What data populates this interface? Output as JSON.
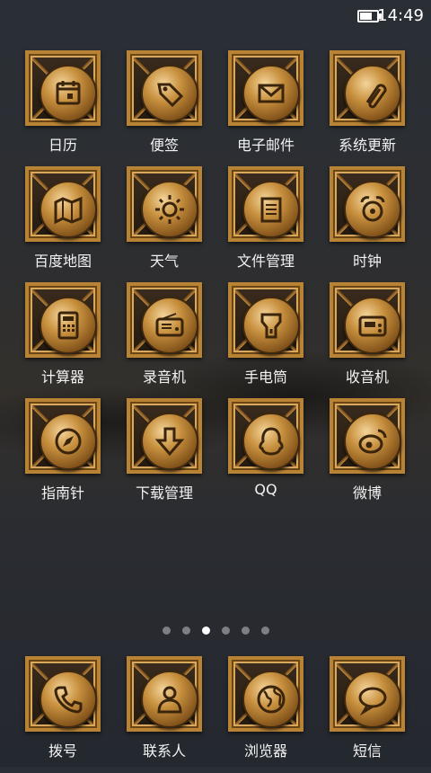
{
  "status_bar": {
    "time": "14:49",
    "battery_level": 0.8
  },
  "apps": [
    {
      "label": "日历",
      "icon": "calendar-icon"
    },
    {
      "label": "便签",
      "icon": "tag-icon"
    },
    {
      "label": "电子邮件",
      "icon": "mail-icon"
    },
    {
      "label": "系统更新",
      "icon": "paperclip-icon"
    },
    {
      "label": "百度地图",
      "icon": "map-icon"
    },
    {
      "label": "天气",
      "icon": "sun-icon"
    },
    {
      "label": "文件管理",
      "icon": "notepad-icon"
    },
    {
      "label": "时钟",
      "icon": "alarm-clock-icon"
    },
    {
      "label": "计算器",
      "icon": "calculator-icon"
    },
    {
      "label": "录音机",
      "icon": "radio-recorder-icon"
    },
    {
      "label": "手电筒",
      "icon": "flashlight-icon"
    },
    {
      "label": "收音机",
      "icon": "radio-icon"
    },
    {
      "label": "指南针",
      "icon": "compass-icon"
    },
    {
      "label": "下载管理",
      "icon": "download-arrow-icon"
    },
    {
      "label": "QQ",
      "icon": "qq-penguin-icon"
    },
    {
      "label": "微博",
      "icon": "weibo-icon"
    }
  ],
  "dock": [
    {
      "label": "拨号",
      "icon": "phone-handset-icon"
    },
    {
      "label": "联系人",
      "icon": "contact-person-icon"
    },
    {
      "label": "浏览器",
      "icon": "globe-icon"
    },
    {
      "label": "短信",
      "icon": "chat-bubble-icon"
    }
  ],
  "pager": {
    "page_count": 6,
    "current_page": 3
  }
}
